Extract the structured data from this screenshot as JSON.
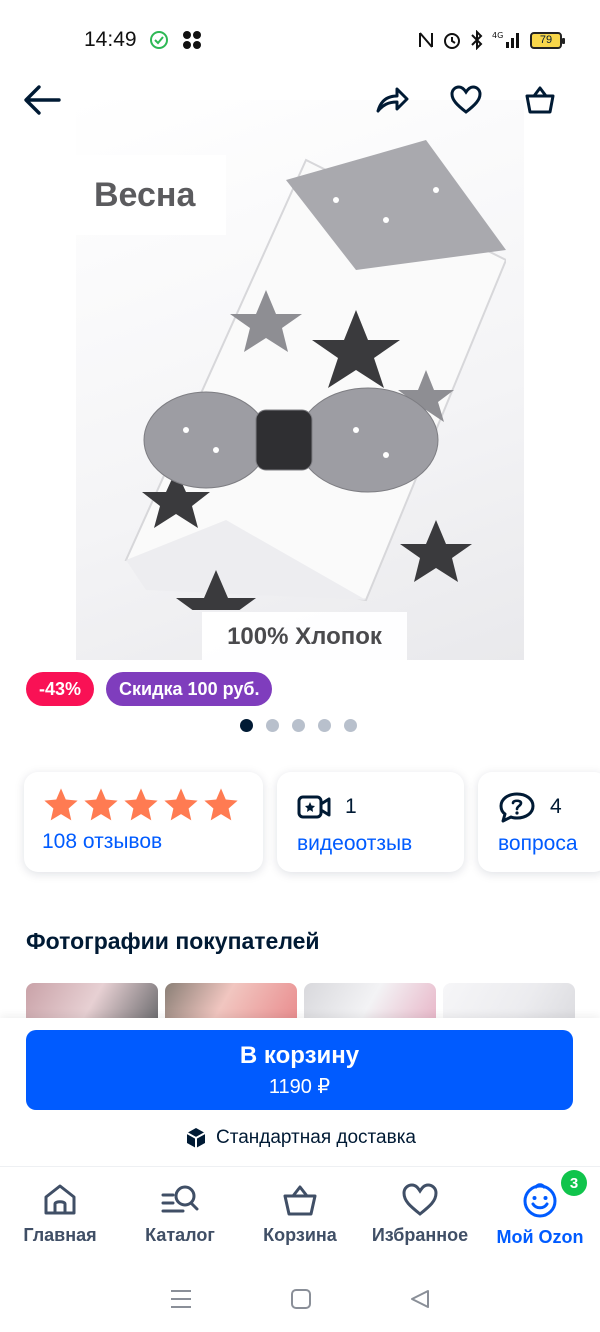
{
  "status_bar": {
    "time": "14:49",
    "battery": "79",
    "network": "4G"
  },
  "header": {
    "back_icon": "arrow-left-icon",
    "share_icon": "share-icon",
    "favorite_icon": "heart-icon",
    "cart_icon": "basket-icon"
  },
  "product_image": {
    "label_top": "Весна",
    "label_bottom": "100% Хлопок"
  },
  "tags": {
    "discount_percent": "-43%",
    "discount_amount": "Скидка 100 руб."
  },
  "gallery": {
    "total": 5,
    "active_index": 0
  },
  "cards": {
    "rating": {
      "stars": 5,
      "reviews": "108 отзывов"
    },
    "video": {
      "count": "1",
      "label": "видеоотзыв"
    },
    "questions": {
      "count": "4",
      "label": "вопроса"
    }
  },
  "section": {
    "buyer_photos_title": "Фотографии покупателей"
  },
  "action": {
    "cart_label": "В корзину",
    "price": "1190 ₽",
    "delivery": "Стандартная доставка"
  },
  "nav": {
    "items": [
      {
        "label": "Главная",
        "icon": "home-icon"
      },
      {
        "label": "Каталог",
        "icon": "catalog-search-icon"
      },
      {
        "label": "Корзина",
        "icon": "basket-icon"
      },
      {
        "label": "Избранное",
        "icon": "heart-icon"
      },
      {
        "label": "Мой Ozon",
        "icon": "profile-smile-icon"
      }
    ],
    "profile_badge": "3"
  },
  "colors": {
    "accent": "#005bff",
    "discount_red": "#f91155",
    "discount_purple": "#7f3dbd",
    "star": "#ff7b52",
    "badge_green": "#10c44c"
  }
}
